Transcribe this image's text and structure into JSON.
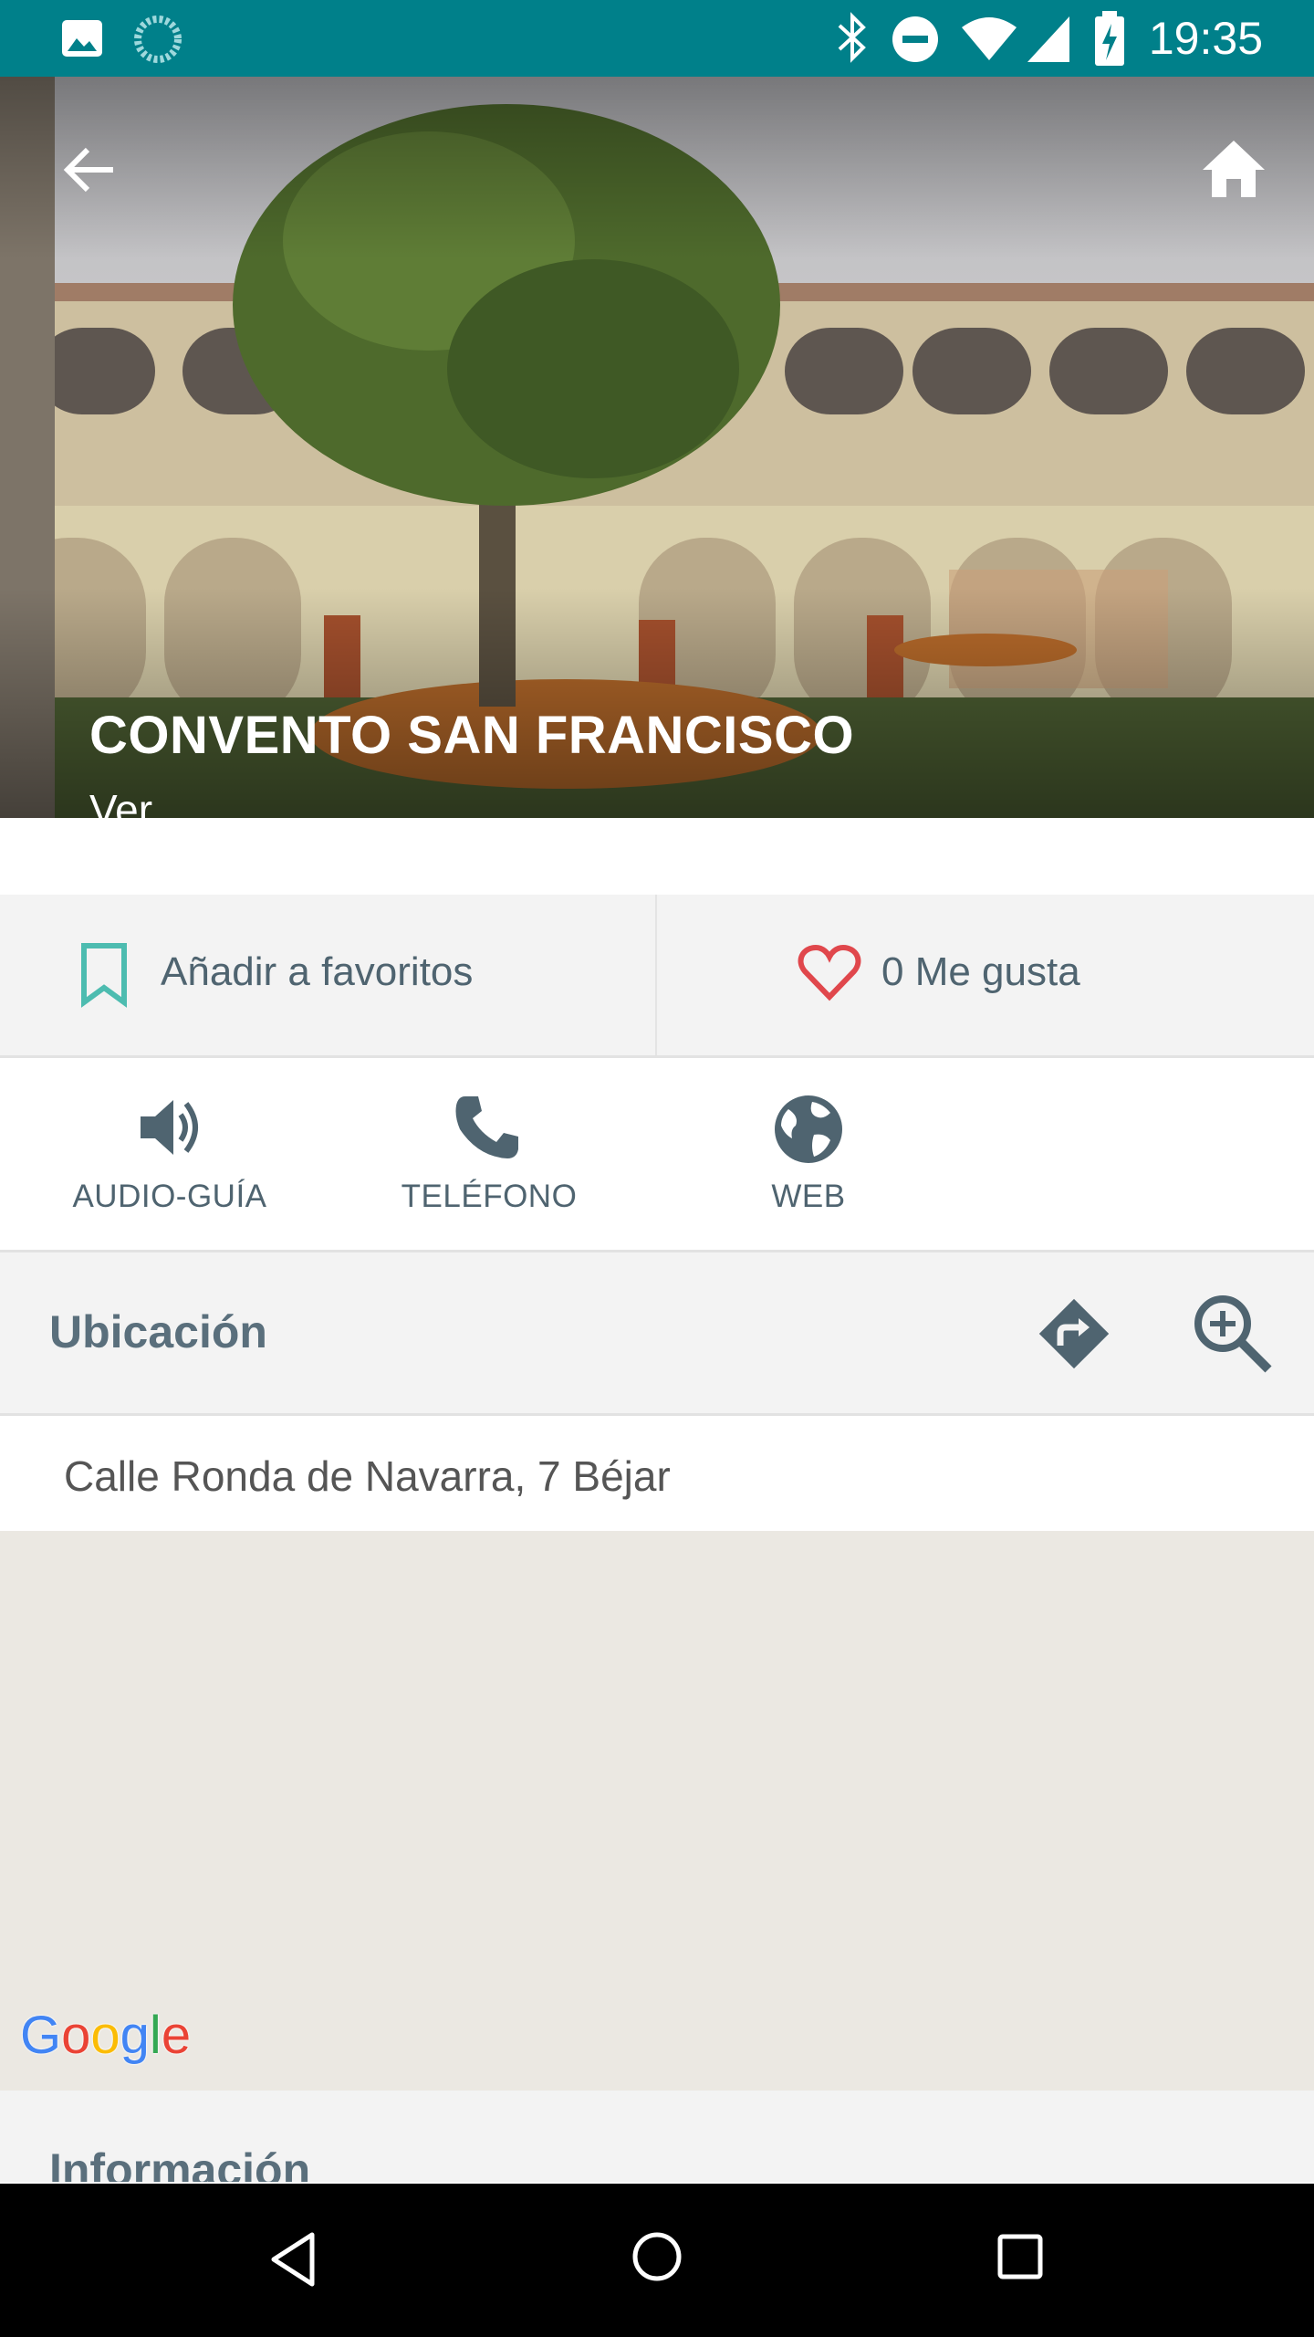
{
  "status_bar": {
    "time": "19:35",
    "left_icons": [
      "image-icon",
      "sync-icon"
    ],
    "right_icons": [
      "bluetooth-icon",
      "dnd-icon",
      "wifi-icon",
      "signal-icon",
      "battery-charging-icon"
    ]
  },
  "toolbar": {
    "back_icon": "arrow-back-icon",
    "home_icon": "home-icon"
  },
  "hero": {
    "title": "CONVENTO SAN FRANCISCO",
    "subtitle": "Ver",
    "pager_dots": 1
  },
  "actions": {
    "favorite_label": "Añadir a favoritos",
    "like_label": "0 Me gusta"
  },
  "quick_buttons": [
    {
      "label": "AUDIO-GUÍA",
      "icon": "volume-icon"
    },
    {
      "label": "TELÉFONO",
      "icon": "phone-icon"
    },
    {
      "label": "WEB",
      "icon": "globe-icon"
    }
  ],
  "location": {
    "title": "Ubicación",
    "address": "Calle Ronda de Navarra, 7 Béjar"
  },
  "map": {
    "attribution": "Google"
  },
  "info": {
    "title": "Información"
  },
  "colors": {
    "status_bar": "#00808a",
    "favorite_icon": "#4dbcb0",
    "like_icon": "#e0474c",
    "icon_slate": "#4f6470"
  }
}
